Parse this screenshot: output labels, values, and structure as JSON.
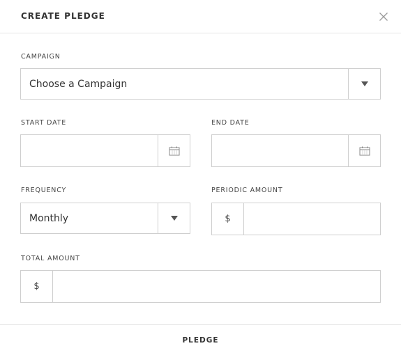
{
  "dialog": {
    "title": "CREATE PLEDGE"
  },
  "campaign": {
    "label": "CAMPAIGN",
    "selected": "Choose a Campaign"
  },
  "start_date": {
    "label": "START DATE",
    "value": ""
  },
  "end_date": {
    "label": "END DATE",
    "value": ""
  },
  "frequency": {
    "label": "FREQUENCY",
    "selected": "Monthly"
  },
  "periodic_amount": {
    "label": "PERIODIC AMOUNT",
    "currency_symbol": "$",
    "value": ""
  },
  "total_amount": {
    "label": "TOTAL AMOUNT",
    "currency_symbol": "$",
    "value": ""
  },
  "footer": {
    "pledge_label": "PLEDGE"
  },
  "icons": {
    "close": "close-icon",
    "dropdown": "chevron-down-icon",
    "calendar": "calendar-icon"
  }
}
